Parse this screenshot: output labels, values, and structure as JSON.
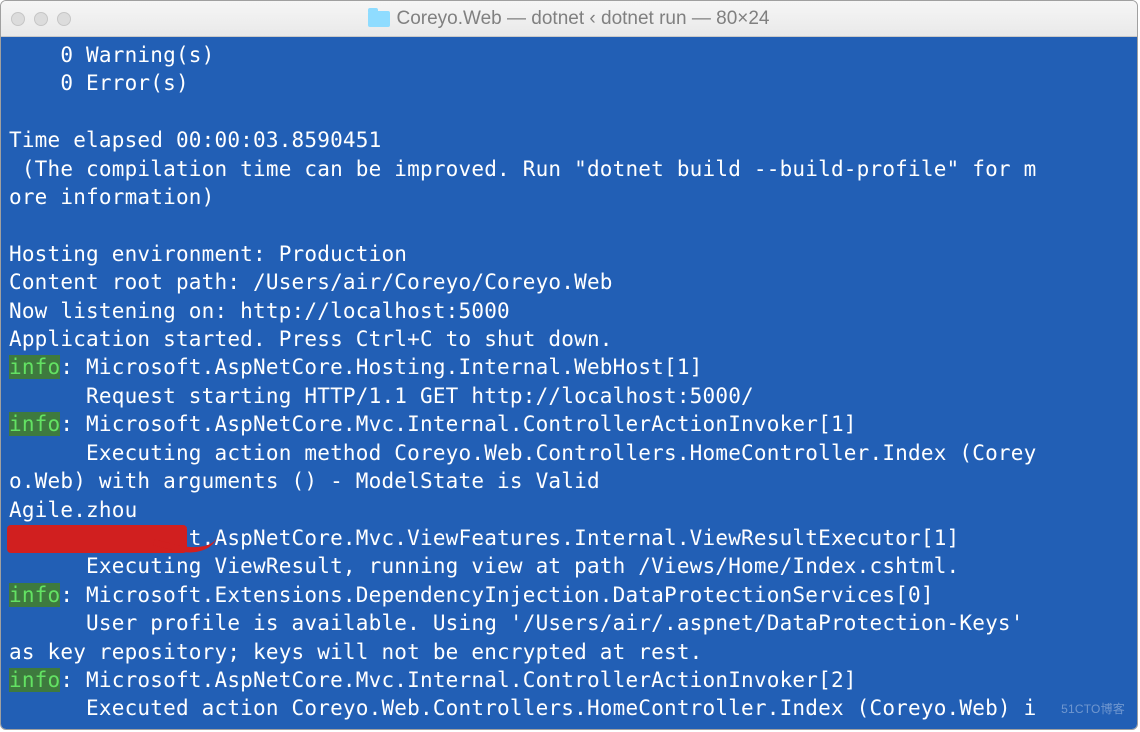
{
  "window": {
    "title": "Coreyo.Web — dotnet ‹ dotnet run — 80×24"
  },
  "terminal": {
    "lines": {
      "l1": "    0 Warning(s)",
      "l2": "    0 Error(s)",
      "l3": "",
      "l4": "Time elapsed 00:00:03.8590451",
      "l5": " (The compilation time can be improved. Run \"dotnet build --build-profile\" for m",
      "l6": "ore information)",
      "l7": "",
      "l8": "Hosting environment: Production",
      "l9": "Content root path: /Users/air/Coreyo/Coreyo.Web",
      "l10": "Now listening on: http://localhost:5000",
      "l11": "Application started. Press Ctrl+C to shut down.",
      "badge1": "info",
      "l12": ": Microsoft.AspNetCore.Hosting.Internal.WebHost[1]",
      "l13": "      Request starting HTTP/1.1 GET http://localhost:5000/  ",
      "badge2": "info",
      "l14": ": Microsoft.AspNetCore.Mvc.Internal.ControllerActionInvoker[1]",
      "l15": "      Executing action method Coreyo.Web.Controllers.HomeController.Index (Corey",
      "l16": "o.Web) with arguments () - ModelState is Valid",
      "l17": "Agile.zhou",
      "l18a": "    ",
      "l18b": ": Microsoft.AspNetCore.Mvc.ViewFeatures.Internal.ViewResultExecutor[1]",
      "l19": "      Executing ViewResult, running view at path /Views/Home/Index.cshtml.",
      "badge3": "info",
      "l20": ": Microsoft.Extensions.DependencyInjection.DataProtectionServices[0]",
      "l21": "      User profile is available. Using '/Users/air/.aspnet/DataProtection-Keys' ",
      "l22": "as key repository; keys will not be encrypted at rest.",
      "badge4": "info",
      "l23": ": Microsoft.AspNetCore.Mvc.Internal.ControllerActionInvoker[2]",
      "l24": "      Executed action Coreyo.Web.Controllers.HomeController.Index (Coreyo.Web) i"
    }
  },
  "watermark": "51CTO博客"
}
